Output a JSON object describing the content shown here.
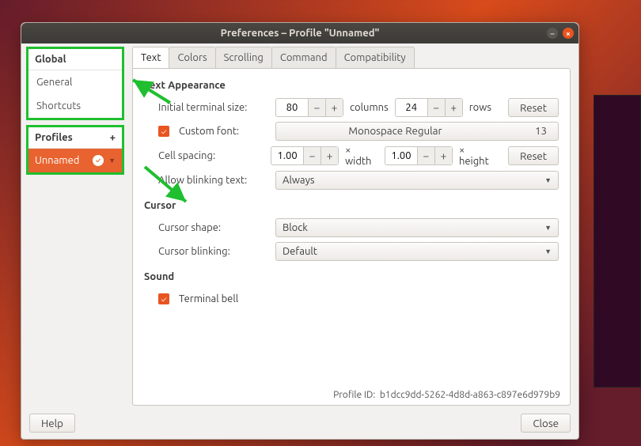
{
  "title": "Preferences – Profile \"Unnamed\"",
  "sidebar": {
    "global_header": "Global",
    "global_items": [
      "General",
      "Shortcuts"
    ],
    "profiles_header": "Profiles",
    "add_profile": "+",
    "profile_name": "Unnamed"
  },
  "tabs": [
    "Text",
    "Colors",
    "Scrolling",
    "Command",
    "Compatibility"
  ],
  "text": {
    "appearance_h": "Text Appearance",
    "init_size_label": "Initial terminal size:",
    "cols_val": "80",
    "cols_unit": "columns",
    "rows_val": "24",
    "rows_unit": "rows",
    "reset": "Reset",
    "custom_font_label": "Custom font:",
    "font_name": "Monospace Regular",
    "font_size": "13",
    "cell_spacing_label": "Cell spacing:",
    "cell_w": "1.00",
    "cell_w_unit": "× width",
    "cell_h": "1.00",
    "cell_h_unit": "× height",
    "blink_label": "Allow blinking text:",
    "blink_value": "Always",
    "cursor_h": "Cursor",
    "cursor_shape_label": "Cursor shape:",
    "cursor_shape_value": "Block",
    "cursor_blink_label": "Cursor blinking:",
    "cursor_blink_value": "Default",
    "sound_h": "Sound",
    "terminal_bell_label": "Terminal bell"
  },
  "profile_id_label": "Profile ID:",
  "profile_id": "b1dcc9dd-5262-4d8d-a863-c897e6d979b9",
  "help": "Help",
  "close": "Close"
}
